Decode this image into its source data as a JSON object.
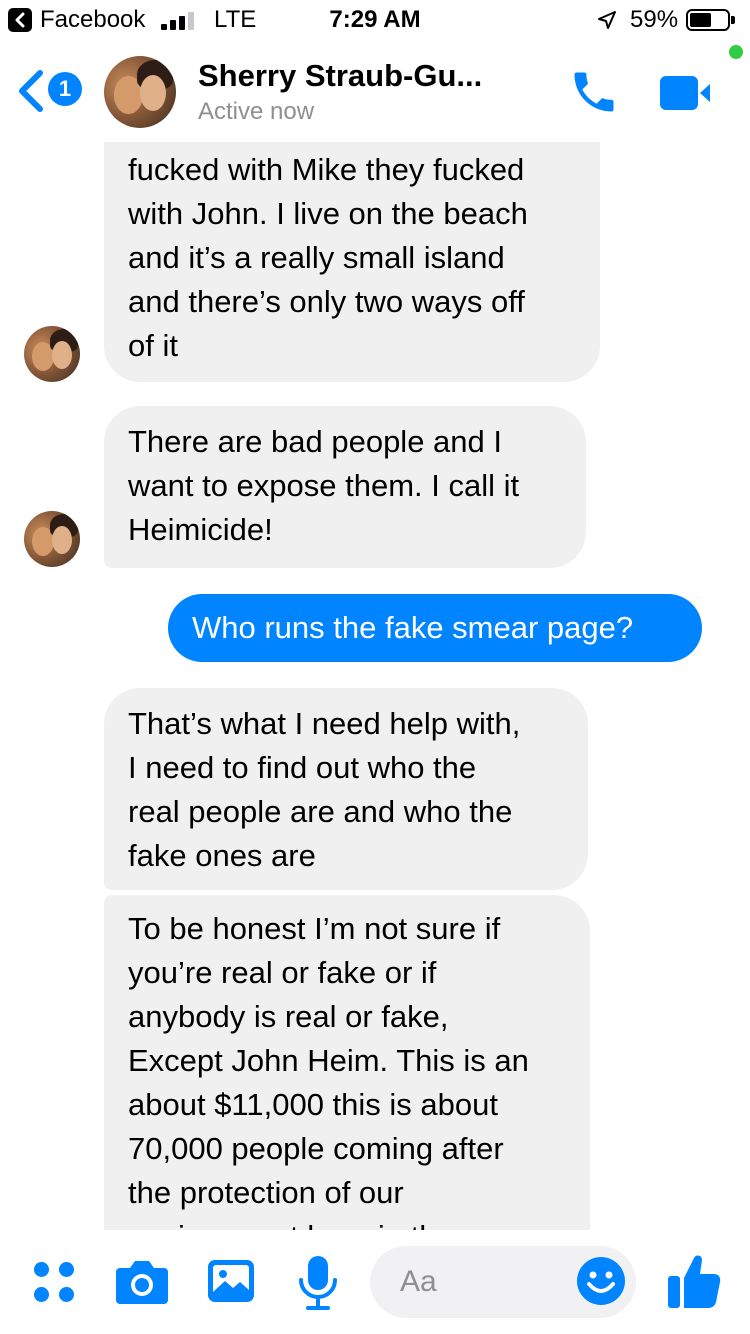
{
  "status_bar": {
    "back_app": "Facebook",
    "network": "LTE",
    "time": "7:29 AM",
    "battery": "59%",
    "battery_level": 0.59,
    "signal_bars_active": 3,
    "signal_bars_total": 4
  },
  "header": {
    "back_badge": "1",
    "contact_name": "Sherry Straub-Gu...",
    "status": "Active now",
    "accent_color": "#0084ff",
    "active_dot_color": "#31cc46"
  },
  "messages": [
    {
      "from": "contact",
      "lines": [
        "fucked with Mike they fucked",
        "with John. I live on the beach",
        "and it’s a really small island",
        "and there’s only two ways off",
        "of it"
      ]
    },
    {
      "from": "contact",
      "lines": [
        "There are bad people and I",
        "want to expose them. I call it",
        "Heimicide!"
      ]
    },
    {
      "from": "me",
      "lines": [
        "Who runs the fake smear page?"
      ]
    },
    {
      "from": "contact",
      "lines": [
        "That’s what I need help with,",
        "I need to find out who the",
        "real people are and who the",
        "fake ones are"
      ]
    },
    {
      "from": "contact",
      "lines": [
        "To be honest I’m not sure if",
        "you’re real or fake or if",
        "anybody is real or fake,",
        "Except John Heim. This is an",
        "about $11,000 this is about",
        "70,000 people coming after",
        "the protection of our",
        "environment here in the"
      ]
    }
  ],
  "composer": {
    "placeholder": "Aa"
  },
  "icons": {
    "back": "chevron-left-icon",
    "call": "phone-icon",
    "video": "video-camera-icon",
    "more": "four-dots-icon",
    "camera": "camera-icon",
    "gallery": "image-icon",
    "mic": "microphone-icon",
    "emoji": "smiley-icon",
    "like": "thumbs-up-icon"
  }
}
